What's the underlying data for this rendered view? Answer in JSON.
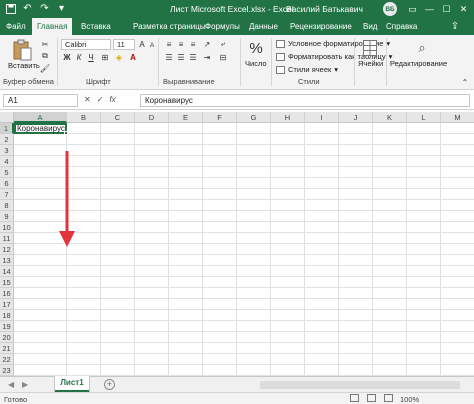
{
  "titlebar": {
    "document_title": "Лист Microsoft Excel.xlsx - Excel",
    "user_name": "Василий Батькавич",
    "avatar_initials": "ВБ"
  },
  "tabs": {
    "file": "Файл",
    "home": "Главная",
    "insert": "Вставка",
    "layout": "Разметка страницы",
    "formulas": "Формулы",
    "data": "Данные",
    "review": "Рецензирование",
    "view": "Вид",
    "help": "Справка"
  },
  "ribbon": {
    "paste_label": "Вставить",
    "clipboard_group": "Буфер обмена",
    "font_name": "Calibri",
    "font_size": "11",
    "font_group": "Шрифт",
    "alignment_group": "Выравнивание",
    "number_label": "Число",
    "conditional_formatting": "Условное форматирование",
    "format_as_table": "Форматировать как таблицу",
    "cell_styles": "Стили ячеек",
    "styles_group": "Стили",
    "cells_label": "Ячейки",
    "editing_label": "Редактирование"
  },
  "formula_bar": {
    "name_box": "A1",
    "fx": "fx",
    "content": "Коронавирус"
  },
  "grid": {
    "columns": [
      "A",
      "B",
      "C",
      "D",
      "E",
      "F",
      "G",
      "H",
      "I",
      "J",
      "K",
      "L",
      "M"
    ],
    "rows": [
      "1",
      "2",
      "3",
      "4",
      "5",
      "6",
      "7",
      "8",
      "9",
      "10",
      "11",
      "12",
      "13",
      "14",
      "15",
      "16",
      "17",
      "18",
      "19",
      "20",
      "21",
      "22",
      "23"
    ],
    "a1_value": "Коронавирус"
  },
  "sheets": {
    "active_sheet": "Лист1"
  },
  "status": {
    "ready": "Готово",
    "zoom": "100%"
  },
  "colors": {
    "brand_green": "#217346",
    "annotation_arrow": "#e3343c"
  }
}
